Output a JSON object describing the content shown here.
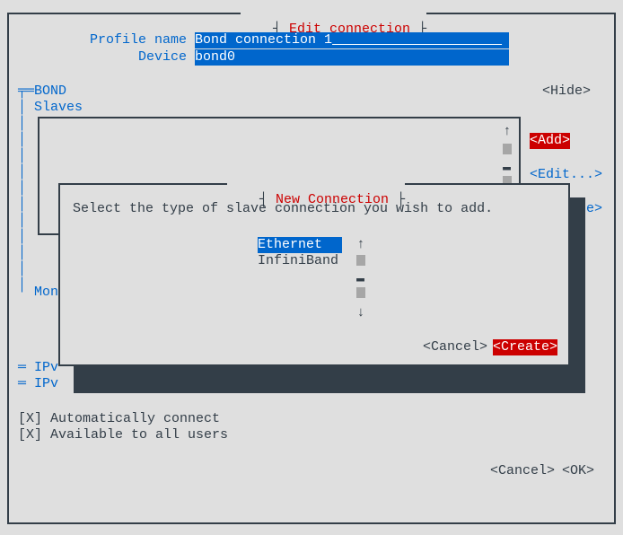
{
  "outer": {
    "title": "Edit connection",
    "profile_label": "Profile name",
    "profile_value": "Bond connection 1",
    "device_label": "Device",
    "device_value": "bond0",
    "bond_label": "BOND",
    "slaves_label": "Slaves",
    "hide_btn": "<Hide>",
    "add_btn": "<Add>",
    "edit_btn": "<Edit...>",
    "delete_btn_tail": "e>",
    "mon_label": "Mon",
    "ipv_a": "IPv",
    "ipv_b": "IPv",
    "auto_connect_label": "[X] Automatically connect",
    "avail_users_label": "[X] Available to all users",
    "cancel_btn": "<Cancel>",
    "ok_btn": "<OK>"
  },
  "dialog": {
    "title": "New Connection",
    "prompt": "Select the type of slave connection you wish to add.",
    "options": [
      "Ethernet",
      "InfiniBand"
    ],
    "cancel_btn": "<Cancel>",
    "create_btn": "<Create>"
  },
  "arrows": {
    "up": "↑",
    "down": "↓"
  }
}
